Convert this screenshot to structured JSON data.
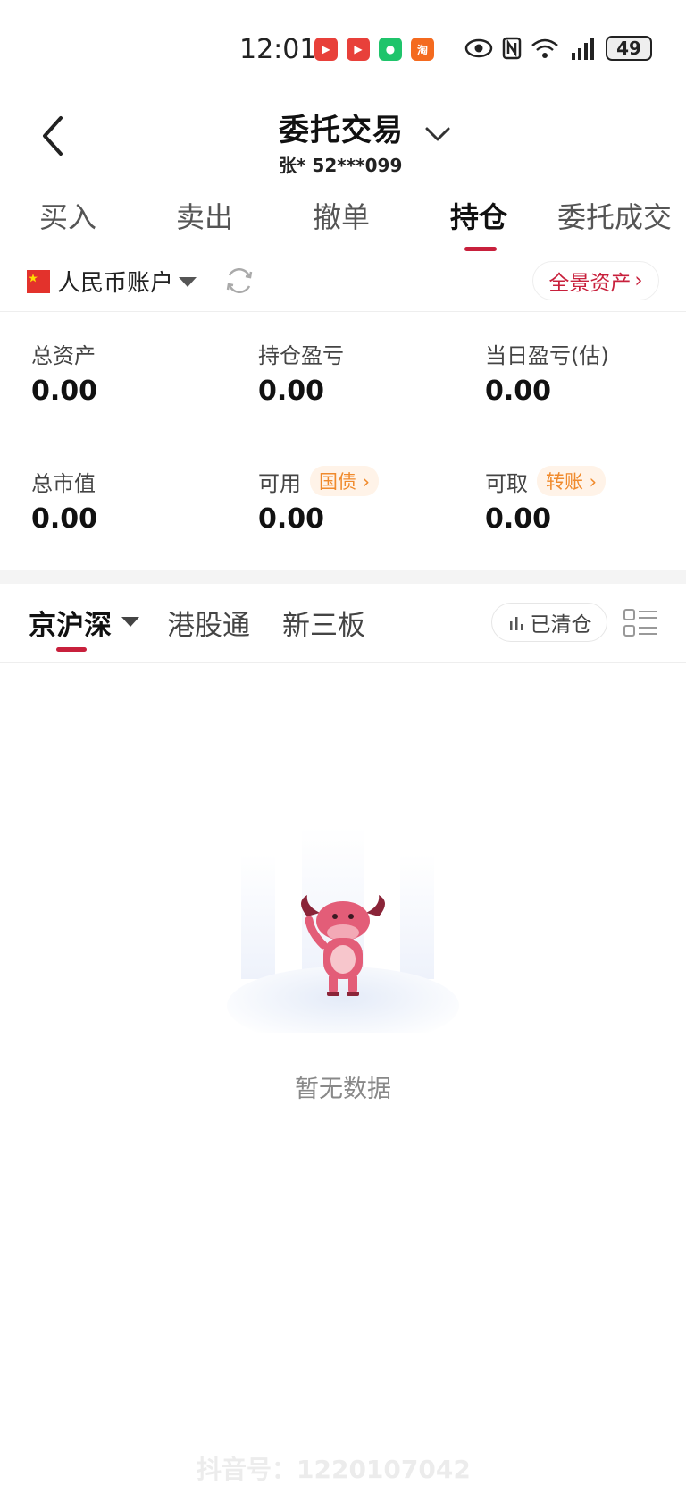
{
  "status_bar": {
    "time": "12:01",
    "battery": "49",
    "app_icons": [
      "video-app-icon",
      "video-app-icon",
      "wechat-icon",
      "taobao-icon"
    ],
    "app_icon_label": "淘"
  },
  "header": {
    "title": "委托交易",
    "account": "张* 52***099"
  },
  "main_tabs": [
    {
      "label": "买入"
    },
    {
      "label": "卖出"
    },
    {
      "label": "撤单"
    },
    {
      "label": "持仓",
      "active": true
    },
    {
      "label": "委托成交"
    }
  ],
  "account_row": {
    "currency_account": "人民币账户",
    "overview_button": "全景资产"
  },
  "summary": {
    "total_assets": {
      "label": "总资产",
      "value": "0.00"
    },
    "position_pnl": {
      "label": "持仓盈亏",
      "value": "0.00"
    },
    "daily_pnl": {
      "label": "当日盈亏(估)",
      "value": "0.00"
    },
    "market_value": {
      "label": "总市值",
      "value": "0.00"
    },
    "available": {
      "label": "可用",
      "value": "0.00",
      "pill": "国债"
    },
    "withdrawable": {
      "label": "可取",
      "value": "0.00",
      "pill": "转账"
    }
  },
  "market_tabs": [
    {
      "label": "京沪深",
      "active": true
    },
    {
      "label": "港股通"
    },
    {
      "label": "新三板"
    }
  ],
  "cleared_button": "已清仓",
  "empty_state": {
    "message": "暂无数据"
  },
  "watermark": "抖音号：1220107042",
  "colors": {
    "accent": "#c8203c",
    "pill_text": "#f08a2c",
    "pill_bg": "#fff3e8"
  }
}
